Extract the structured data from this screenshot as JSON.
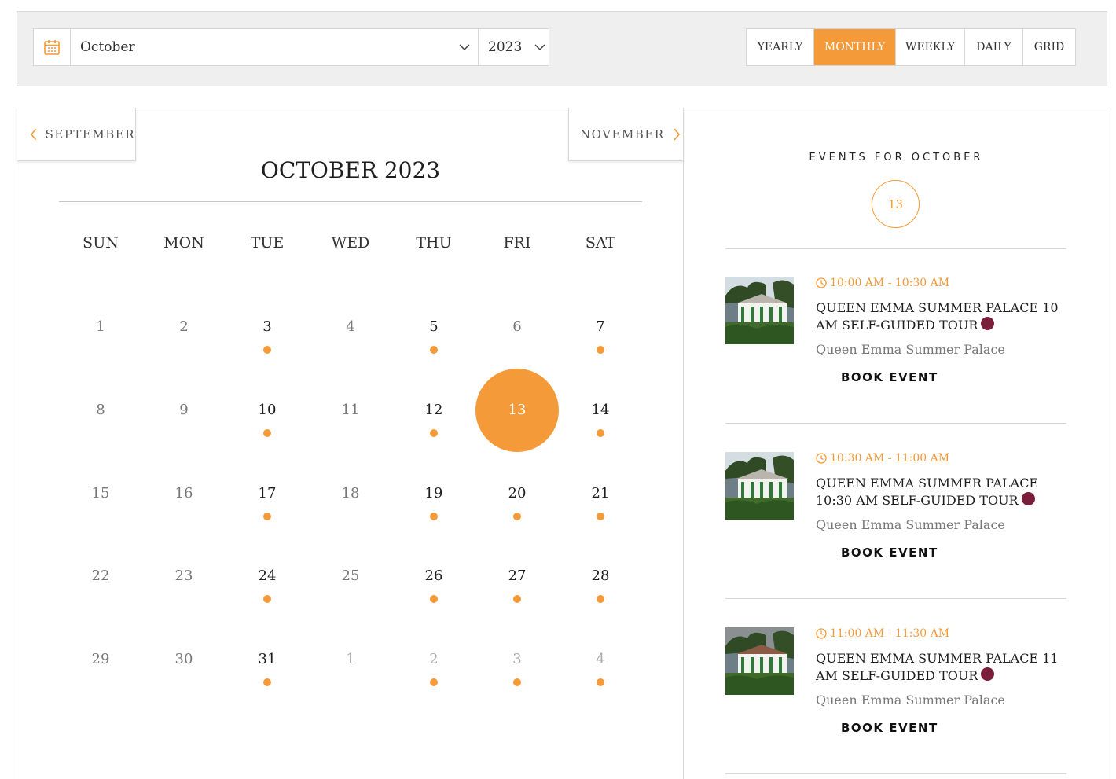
{
  "filter": {
    "calendar_icon": "calendar-icon",
    "month": "October",
    "year": "2023",
    "views": [
      {
        "label": "YEARLY",
        "active": false
      },
      {
        "label": "MONTHLY",
        "active": true
      },
      {
        "label": "WEEKLY",
        "active": false
      },
      {
        "label": "DAILY",
        "active": false
      },
      {
        "label": "GRID",
        "active": false
      }
    ]
  },
  "calendar": {
    "prev_label": "SEPTEMBER",
    "next_label": "NOVEMBER",
    "title": "OCTOBER 2023",
    "weekdays": [
      "SUN",
      "MON",
      "TUE",
      "WED",
      "THU",
      "FRI",
      "SAT"
    ],
    "weeks": [
      [
        {
          "d": "1"
        },
        {
          "d": "2"
        },
        {
          "d": "3",
          "ev": true
        },
        {
          "d": "4"
        },
        {
          "d": "5",
          "ev": true
        },
        {
          "d": "6"
        },
        {
          "d": "7",
          "ev": true
        }
      ],
      [
        {
          "d": "8"
        },
        {
          "d": "9"
        },
        {
          "d": "10",
          "ev": true
        },
        {
          "d": "11"
        },
        {
          "d": "12",
          "ev": true
        },
        {
          "d": "13",
          "sel": true
        },
        {
          "d": "14",
          "ev": true
        }
      ],
      [
        {
          "d": "15"
        },
        {
          "d": "16"
        },
        {
          "d": "17",
          "ev": true
        },
        {
          "d": "18"
        },
        {
          "d": "19",
          "ev": true
        },
        {
          "d": "20",
          "ev": true
        },
        {
          "d": "21",
          "ev": true
        }
      ],
      [
        {
          "d": "22"
        },
        {
          "d": "23"
        },
        {
          "d": "24",
          "ev": true
        },
        {
          "d": "25"
        },
        {
          "d": "26",
          "ev": true
        },
        {
          "d": "27",
          "ev": true
        },
        {
          "d": "28",
          "ev": true
        }
      ],
      [
        {
          "d": "29"
        },
        {
          "d": "30"
        },
        {
          "d": "31",
          "ev": true
        },
        {
          "d": "1",
          "other": true
        },
        {
          "d": "2",
          "ev": true,
          "other": true
        },
        {
          "d": "3",
          "ev": true,
          "other": true
        },
        {
          "d": "4",
          "ev": true,
          "other": true
        }
      ]
    ]
  },
  "events_panel": {
    "heading": "EVENTS FOR OCTOBER",
    "day": "13",
    "events": [
      {
        "time": "10:00 AM - 10:30 AM",
        "title": "QUEEN EMMA SUMMER PALACE 10 AM SELF-GUIDED TOUR",
        "venue": "Queen Emma Summer Palace",
        "action": "BOOK EVENT"
      },
      {
        "time": "10:30 AM - 11:00 AM",
        "title": "QUEEN EMMA SUMMER PALACE 10:30 AM SELF-GUIDED TOUR",
        "venue": "Queen Emma Summer Palace",
        "action": "BOOK EVENT"
      },
      {
        "time": "11:00 AM - 11:30 AM",
        "title": "QUEEN EMMA SUMMER PALACE 11 AM SELF-GUIDED TOUR",
        "venue": "Queen Emma Summer Palace",
        "action": "BOOK EVENT"
      }
    ]
  },
  "colors": {
    "accent": "#f59a38",
    "category_pin": "#7a1e3c"
  }
}
